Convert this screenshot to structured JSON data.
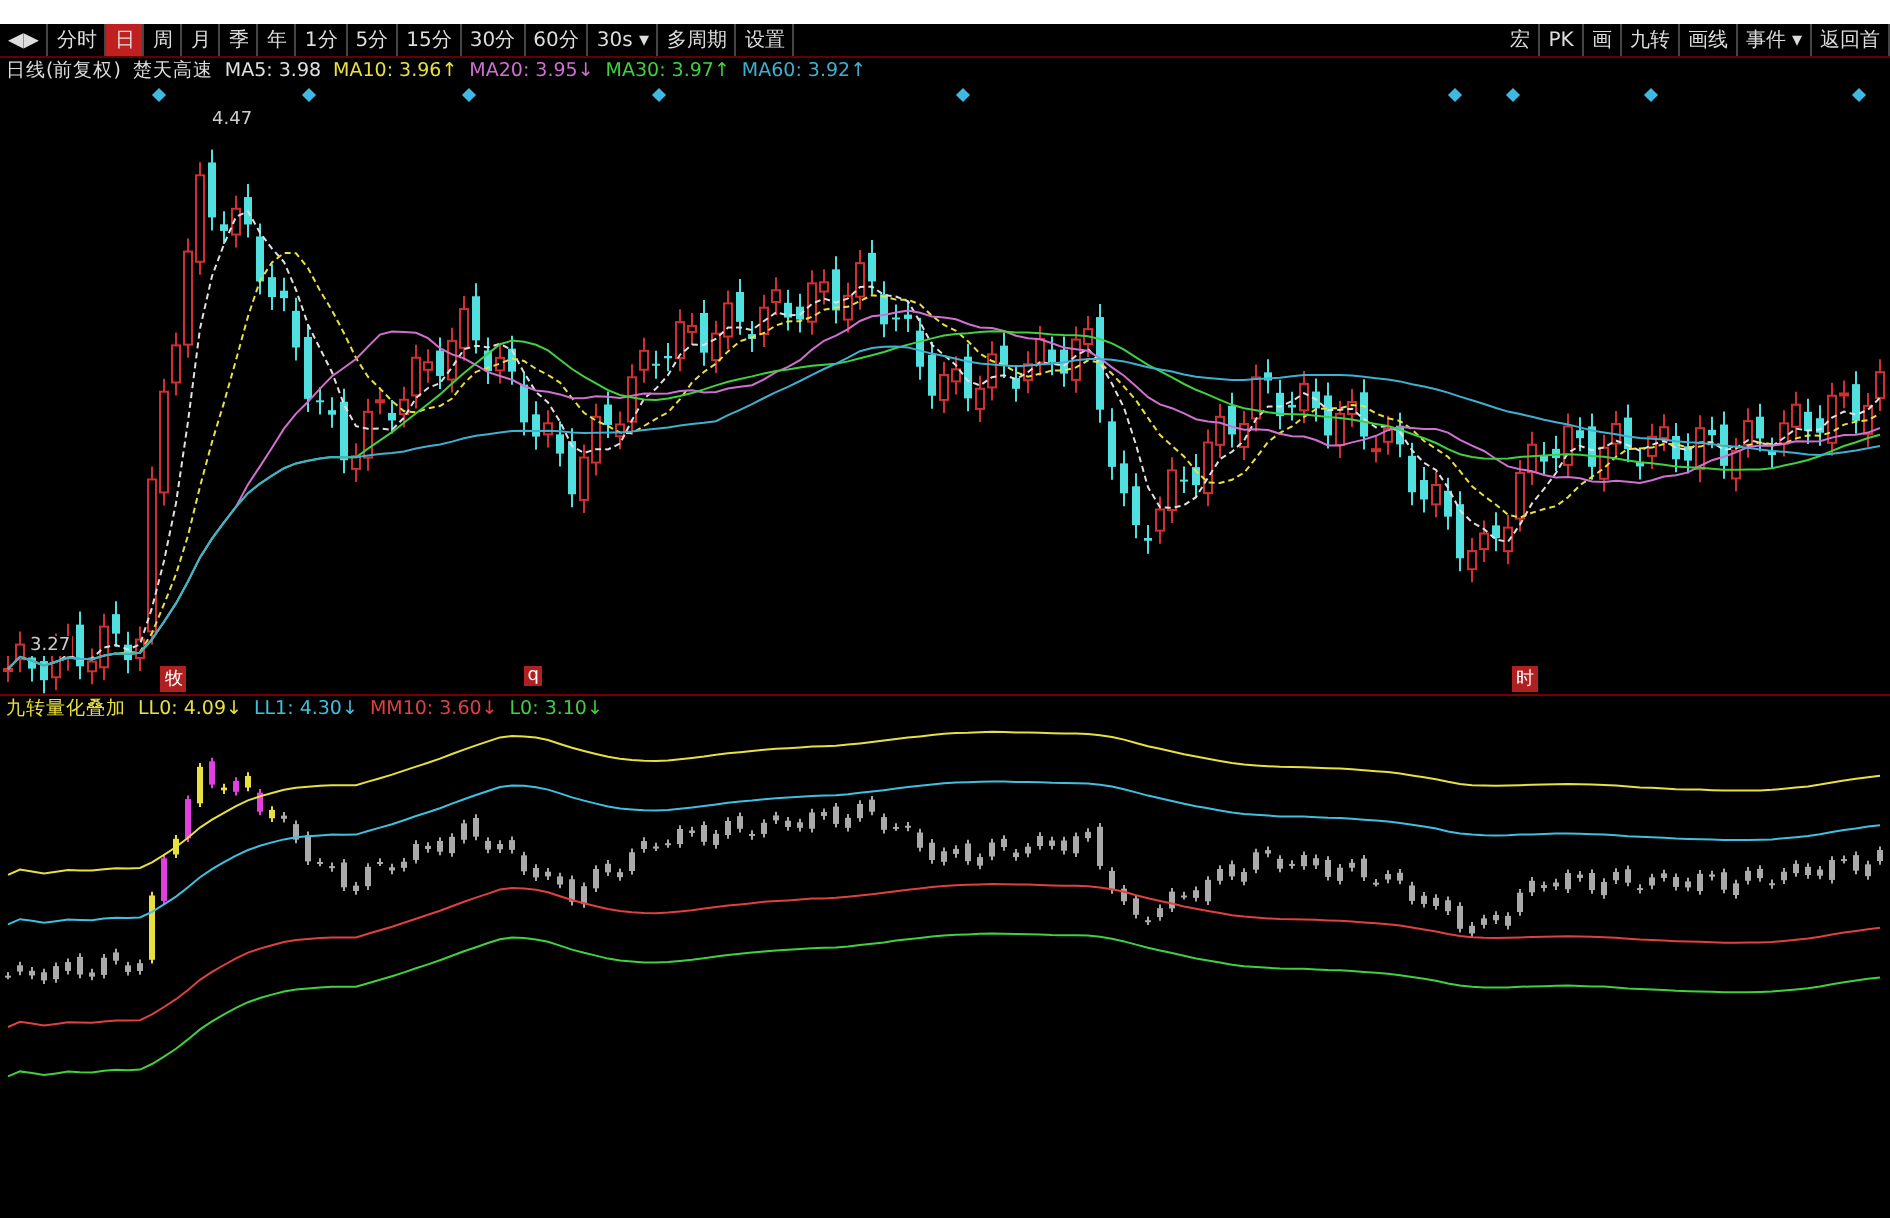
{
  "toolbar": {
    "left": [
      {
        "label": "◀▶",
        "selected": false
      },
      {
        "label": "分时",
        "selected": false
      },
      {
        "label": "日",
        "selected": true
      },
      {
        "label": "周",
        "selected": false
      },
      {
        "label": "月",
        "selected": false
      },
      {
        "label": "季",
        "selected": false
      },
      {
        "label": "年",
        "selected": false
      },
      {
        "label": "1分",
        "selected": false
      },
      {
        "label": "5分",
        "selected": false
      },
      {
        "label": "15分",
        "selected": false
      },
      {
        "label": "30分",
        "selected": false
      },
      {
        "label": "60分",
        "selected": false
      },
      {
        "label": "30s ▾",
        "selected": false
      },
      {
        "label": "多周期",
        "selected": false
      },
      {
        "label": "设置",
        "selected": false
      }
    ],
    "right": [
      "宏",
      "PK",
      "画",
      "九转",
      "画线",
      "事件 ▾",
      "返回首"
    ]
  },
  "main_chart": {
    "title": "日线(前复权)",
    "name": "楚天高速",
    "legend": [
      {
        "text": "MA5: 3.98",
        "color": "#e0e0e0"
      },
      {
        "text": "MA10: 3.96↑",
        "color": "#e8e040"
      },
      {
        "text": "MA20: 3.95↓",
        "color": "#d070d0"
      },
      {
        "text": "MA30: 3.97↑",
        "color": "#40d040"
      },
      {
        "text": "MA60: 3.92↑",
        "color": "#40b0d0"
      }
    ],
    "high_label": "4.47",
    "low_label": "3.27",
    "markers": [
      "牧",
      "q",
      "时"
    ]
  },
  "indicator": {
    "name": "九转量化叠加",
    "legend": [
      {
        "text": "LL0: 4.09↓",
        "color": "#e8e040"
      },
      {
        "text": "LL1: 4.30↓",
        "color": "#40c0e0"
      },
      {
        "text": "MM10: 3.60↓",
        "color": "#e04040"
      },
      {
        "text": "L0: 3.10↓",
        "color": "#40d040"
      }
    ]
  }
}
